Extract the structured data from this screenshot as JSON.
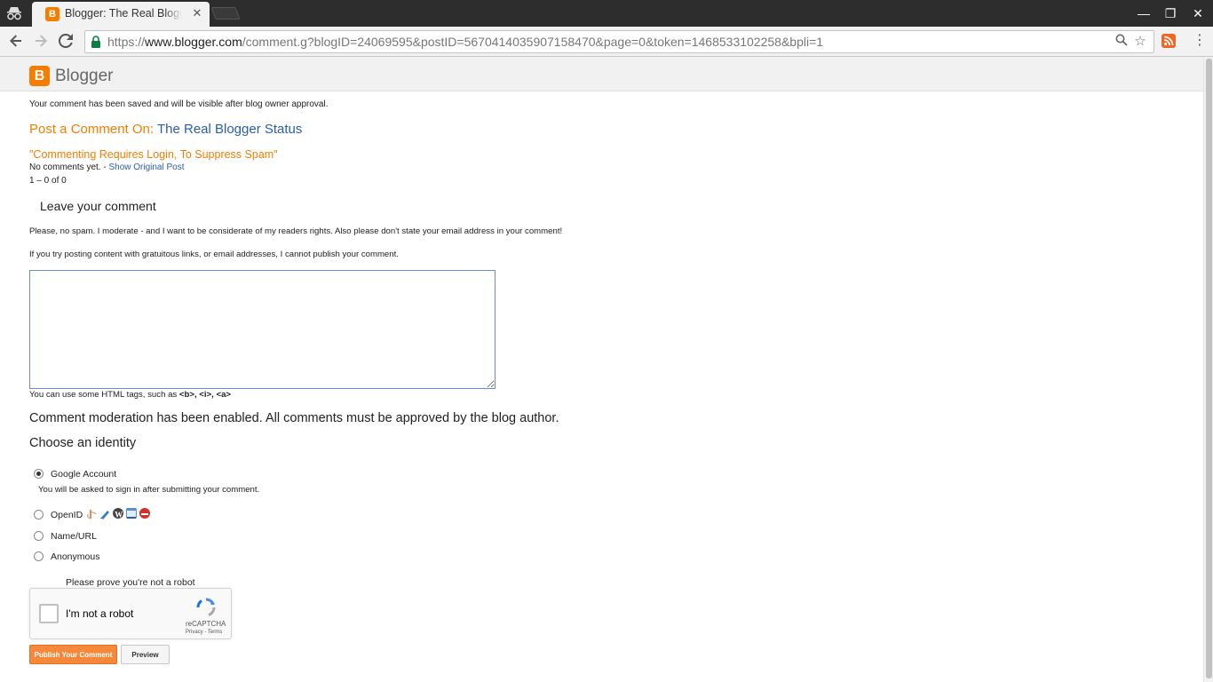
{
  "browser": {
    "tab_title": "Blogger: The Real Blogger Status",
    "tab_favicon_letter": "B",
    "tab_close": "✕",
    "url_scheme": "https://",
    "url_host": "www.blogger.com",
    "url_path": "/comment.g?blogID=24069595&postID=5670414035907158470&page=0&token=1468533102258&bpli=1",
    "back_icon": "arrow-left-icon",
    "forward_icon": "arrow-right-icon",
    "reload_icon": "reload-icon",
    "minimize": "—",
    "restore": "❐",
    "close": "✕",
    "menu": "⋮"
  },
  "header": {
    "logo_letter": "B",
    "brand": "Blogger"
  },
  "notice": "Your comment has been saved and will be visible after blog owner approval.",
  "post": {
    "prefix": "Post a Comment On:",
    "blog_name": "The Real Blogger Status",
    "title": "\"Commenting Requires Login, To Suppress Spam\"",
    "no_comments": "No comments yet. - ",
    "show_original": "Show Original Post",
    "count": "1 – 0 of 0"
  },
  "comment_form": {
    "heading": "Leave your comment",
    "message1": "Please, no spam. I moderate - and I want to be considerate of my readers rights. Also please don't state your email address in your comment!",
    "message2": "If you try posting content with gratuitous links, or email addresses, I cannot publish your comment.",
    "textarea_value": "",
    "html_hint_prefix": "You can use some HTML tags, such as ",
    "html_hint_tags": "<b>, <i>, <a>",
    "moderation": "Comment moderation has been enabled. All comments must be approved by the blog author.",
    "choose_identity": "Choose an identity"
  },
  "identity": {
    "selected": "Google Account",
    "options": [
      {
        "label": "Google Account",
        "checked": true
      },
      {
        "label": "OpenID",
        "checked": false
      },
      {
        "label": "Name/URL",
        "checked": false
      },
      {
        "label": "Anonymous",
        "checked": false
      }
    ],
    "google_note": "You will be asked to sign in after submitting your comment."
  },
  "captcha": {
    "prompt": "Please prove you're not a robot",
    "label": "I'm not a robot",
    "brand": "reCAPTCHA",
    "terms": "Privacy - Terms"
  },
  "buttons": {
    "publish": "Publish Your Comment",
    "preview": "Preview"
  },
  "colors": {
    "blogger_orange": "#f57d00",
    "link_blue": "#2a5db0",
    "tabstrip": "#2d2d2d",
    "toolbar": "#f2f2f2"
  }
}
